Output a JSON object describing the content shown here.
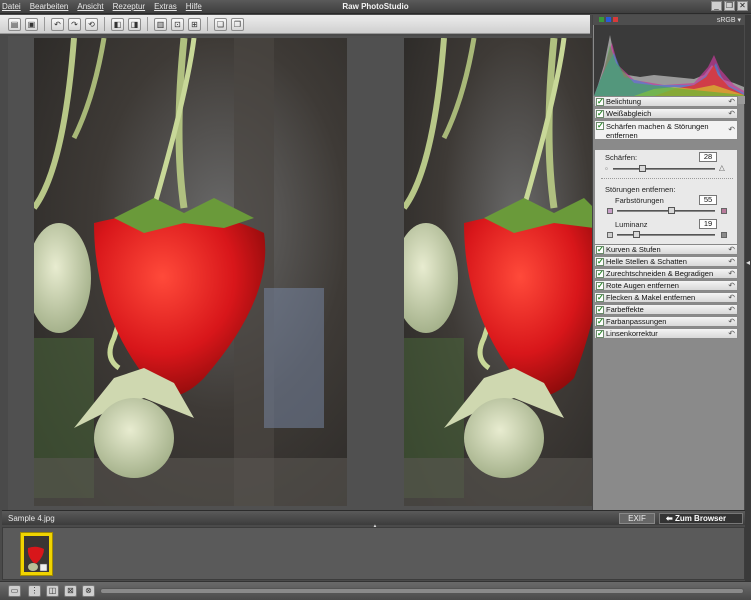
{
  "app": {
    "title": "Raw PhotoStudio",
    "menu": [
      "Datei",
      "Bearbeiten",
      "Ansicht",
      "Rezeptur",
      "Extras",
      "Hilfe"
    ],
    "window_controls": [
      "_",
      "❐",
      "✕"
    ]
  },
  "toolbar": {
    "icons": [
      "open-icon",
      "save-icon",
      "undo-icon",
      "redo-icon",
      "revert-icon",
      "rotate-left-icon",
      "rotate-right-icon",
      "compare-icon",
      "fit-icon",
      "actual-size-icon",
      "copy-settings-icon",
      "paste-settings-icon"
    ]
  },
  "statusbar": {
    "filename": "Sample 4.jpg",
    "exif_label": "EXIF",
    "browser_label": "Zum Browser"
  },
  "histogram": {
    "colorspace": "sRGB ▾",
    "channel_colors": [
      "#3a9a3a",
      "#2a5ad8",
      "#d83a3a"
    ]
  },
  "panel": {
    "sections": [
      {
        "label": "Belichtung"
      },
      {
        "label": "Weißabgleich"
      },
      {
        "label": "Schärfen machen & Störungen entfernen",
        "open": true
      },
      {
        "label": "Kurven & Stufen"
      },
      {
        "label": "Helle Stellen & Schatten"
      },
      {
        "label": "Zurechtschneiden & Begradigen"
      },
      {
        "label": "Rote Augen entfernen"
      },
      {
        "label": "Flecken & Makel entfernen"
      },
      {
        "label": "Farbeffekte"
      },
      {
        "label": "Farbanpassungen"
      },
      {
        "label": "Linsenkorrektur"
      }
    ],
    "sharpen": {
      "label": "Schärfen:",
      "value": "28",
      "level": 0.28
    },
    "noise": {
      "label": "Störungen entfernen:",
      "color_label": "Farbstörungen",
      "color_value": "55",
      "color_level": 0.55,
      "luminance_label": "Luminanz",
      "luminance_value": "19",
      "luminance_level": 0.19
    }
  }
}
